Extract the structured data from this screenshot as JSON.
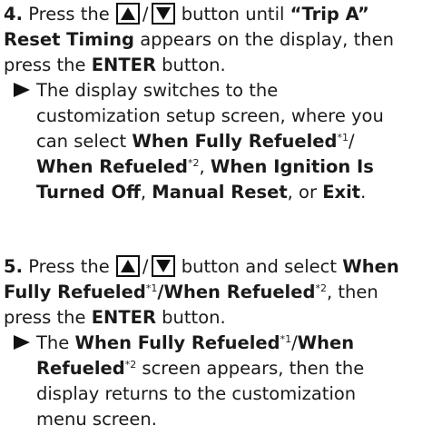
{
  "step4": {
    "num": "4.",
    "l1_a": "Press the",
    "l1_b": "button until",
    "l1_c": "“Trip A”",
    "l2_a": "Reset Timing",
    "l2_b": "appears on the display, then",
    "l3_a": "press the",
    "l3_b": "ENTER",
    "l3_c": "button.",
    "r1": "The display switches to the",
    "r2": "customization setup screen, where you",
    "r3_a": "can select",
    "r3_b": "When Fully Refueled",
    "r3_c": "*1",
    "r3_d": "/",
    "r4_a": "When Refueled",
    "r4_b": "*2",
    "r4_c": ",",
    "r4_d": "When Ignition Is",
    "r5_a": "Turned Off",
    "r5_b": ",",
    "r5_c": "Manual Reset",
    "r5_d": ", or",
    "r5_e": "Exit",
    "r5_f": "."
  },
  "step5": {
    "num": "5.",
    "l1_a": "Press the",
    "l1_b": "button and select",
    "l1_c": "When",
    "l2_a": "Fully Refueled",
    "l2_b": "*1",
    "l2_c": "/",
    "l2_d": "When Refueled",
    "l2_e": "*2",
    "l2_f": ", then",
    "l3_a": "press the",
    "l3_b": "ENTER",
    "l3_c": "button.",
    "r1_a": "The",
    "r1_b": "When Fully Refueled",
    "r1_c": "*1",
    "r1_d": "/",
    "r1_e": "When",
    "r2_a": "Refueled",
    "r2_b": "*2",
    "r2_c": "screen appears, then the",
    "r3": "display returns to the customization",
    "r4": "menu screen."
  },
  "icons": {
    "up": "up-arrow-button-icon",
    "down": "down-arrow-button-icon",
    "result": "result-arrow-icon"
  }
}
